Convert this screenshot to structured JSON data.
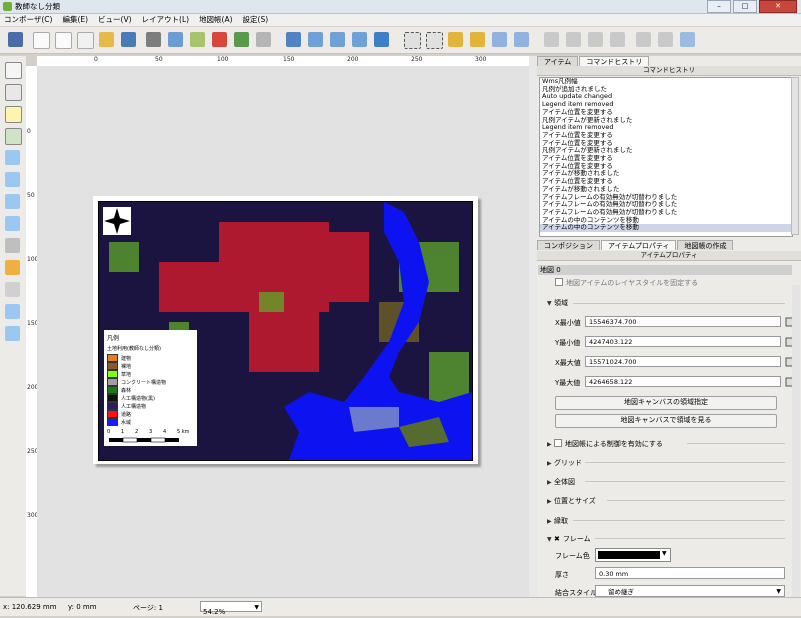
{
  "window": {
    "title": "教師なし分類"
  },
  "menu": [
    "コンポーザ(C)",
    "編集(E)",
    "ビュー(V)",
    "レイアウト(L)",
    "地図帳(A)",
    "設定(S)"
  ],
  "ruler": {
    "h": [
      "0",
      "50",
      "100",
      "150",
      "200",
      "250",
      "300"
    ],
    "v": [
      "0",
      "50",
      "100",
      "150",
      "200",
      "250",
      "300"
    ]
  },
  "right_panel": {
    "top_tabs": [
      "アイテム",
      "コマンドヒストリ"
    ],
    "history_title": "コマンドヒストリ",
    "history": [
      "Wms凡例幅",
      "凡例が追加されました",
      "Auto update changed",
      "Legend item removed",
      "アイテム位置を変更する",
      "凡例アイテムが更新されました",
      "Legend item removed",
      "アイテム位置を変更する",
      "アイテム位置を変更する",
      "凡例アイテムが更新されました",
      "アイテム位置を変更する",
      "アイテム位置を変更する",
      "アイテムが移動されました",
      "アイテム位置を変更する",
      "アイテムが移動されました",
      "アイテムフレームの有効無効が切替わりました",
      "アイテムフレームの有効無効が切替わりました",
      "アイテムフレームの有効無効が切替わりました",
      "アイテムの中のコンテンツを移動",
      "アイテムの中のコンテンツを移動"
    ],
    "bottom_tabs": [
      "コンポジション",
      "アイテムプロパティ",
      "地図帳の作成"
    ],
    "props_title": "アイテムプロパティ",
    "map_header": "地図 0",
    "lock_layers": "地図アイテムのレイヤスタイルを固定する",
    "extent_label": "領域",
    "fields": [
      {
        "label": "X最小値",
        "value": "15546374.700"
      },
      {
        "label": "Y最小値",
        "value": "4247403.122"
      },
      {
        "label": "X最大値",
        "value": "15571024.700"
      },
      {
        "label": "Y最大値",
        "value": "4264658.122"
      }
    ],
    "btn_set_extent": "地図キャンバスの領域指定",
    "btn_view_extent": "地図キャンバスで領域を見る",
    "atlas_control": "地図帳による制御を有効にする",
    "sections": [
      "グリッド",
      "全体図",
      "位置とサイズ",
      "縁取"
    ],
    "frame_label": "フレーム",
    "frame_color_label": "フレーム色",
    "frame_color": "#000000",
    "thickness_label": "厚さ",
    "thickness_value": "0.30 mm",
    "join_label": "結合スタイル",
    "join_value": "留め継ぎ"
  },
  "legend": {
    "title": "凡例",
    "subtitle": "土地利用(教師なし分類)",
    "items": [
      {
        "label": "建物",
        "color": "#e87d1e"
      },
      {
        "label": "裸地",
        "color": "#8b5a2b"
      },
      {
        "label": "草地",
        "color": "#7fff00"
      },
      {
        "label": "コンクリート構造物",
        "color": "#a0a0a0"
      },
      {
        "label": "森林",
        "color": "#1a7a1a"
      },
      {
        "label": "人工構造物(黒)",
        "color": "#111111"
      },
      {
        "label": "人工構造物",
        "color": "#2a1f5e"
      },
      {
        "label": "道路",
        "color": "#ff1010"
      },
      {
        "label": "水域",
        "color": "#1a1aff"
      }
    ],
    "scale_labels": [
      "0",
      "1",
      "2",
      "3",
      "4",
      "5 km"
    ]
  },
  "status": {
    "x": "x: 120.629 mm",
    "y": "y: 0 mm",
    "page": "ページ: 1",
    "zoom": "54.2%"
  }
}
